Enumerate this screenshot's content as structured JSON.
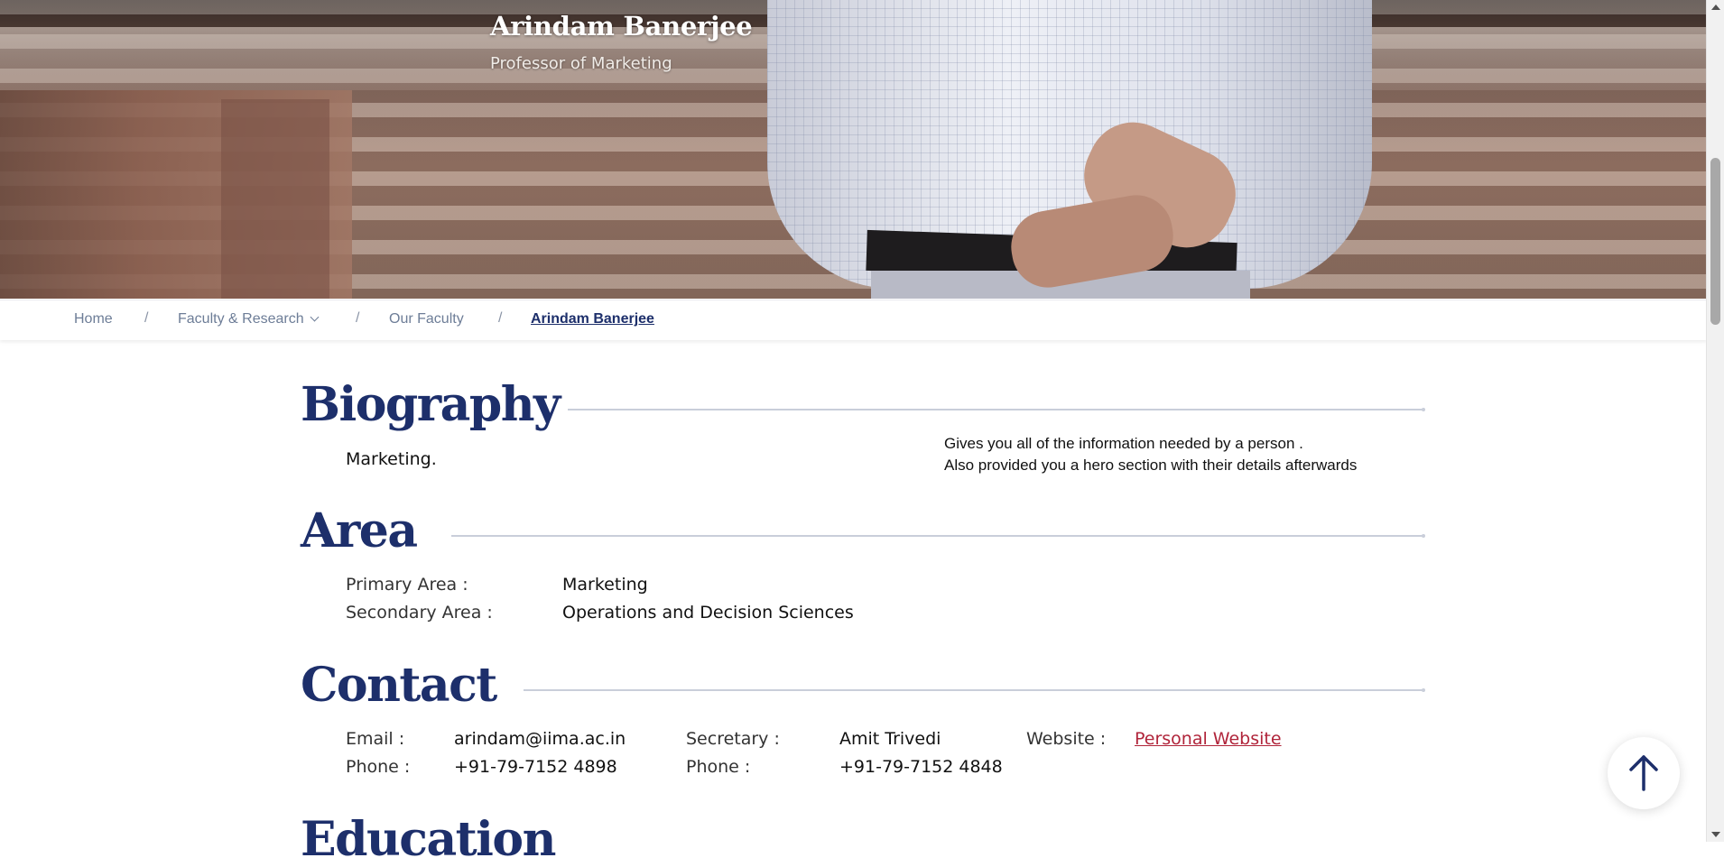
{
  "hero": {
    "name": "Arindam Banerjee",
    "title": "Professor of Marketing"
  },
  "breadcrumb": {
    "items": [
      {
        "label": "Home"
      },
      {
        "label": "Faculty & Research"
      },
      {
        "label": "Our Faculty"
      },
      {
        "label": "Arindam Banerjee"
      }
    ],
    "separator": "/"
  },
  "biography": {
    "heading": "Biography",
    "text": "Marketing.",
    "note_line1": "Gives you all of the information needed by a person .",
    "note_line2": "Also provided you a hero section with their details afterwards"
  },
  "area": {
    "heading": "Area",
    "primary_label": "Primary Area :",
    "primary_value": "Marketing",
    "secondary_label": "Secondary Area :",
    "secondary_value": "Operations and Decision Sciences"
  },
  "contact": {
    "heading": "Contact",
    "email_label": "Email :",
    "email_value": "arindam@iima.ac.in",
    "phone_label": "Phone :",
    "phone_value": "+91-79-7152 4898",
    "secretary_label": "Secretary :",
    "secretary_value": "Amit Trivedi",
    "secretary_phone_label": "Phone :",
    "secretary_phone_value": "+91-79-7152 4848",
    "website_label": "Website :",
    "website_link": "Personal Website"
  },
  "education": {
    "heading": "Education"
  },
  "colors": {
    "accent": "#1d2f6b",
    "link": "#b0243a"
  },
  "icons": {
    "back_to_top": "arrow-up-icon",
    "breadcrumb_dropdown": "chevron-down-icon"
  }
}
